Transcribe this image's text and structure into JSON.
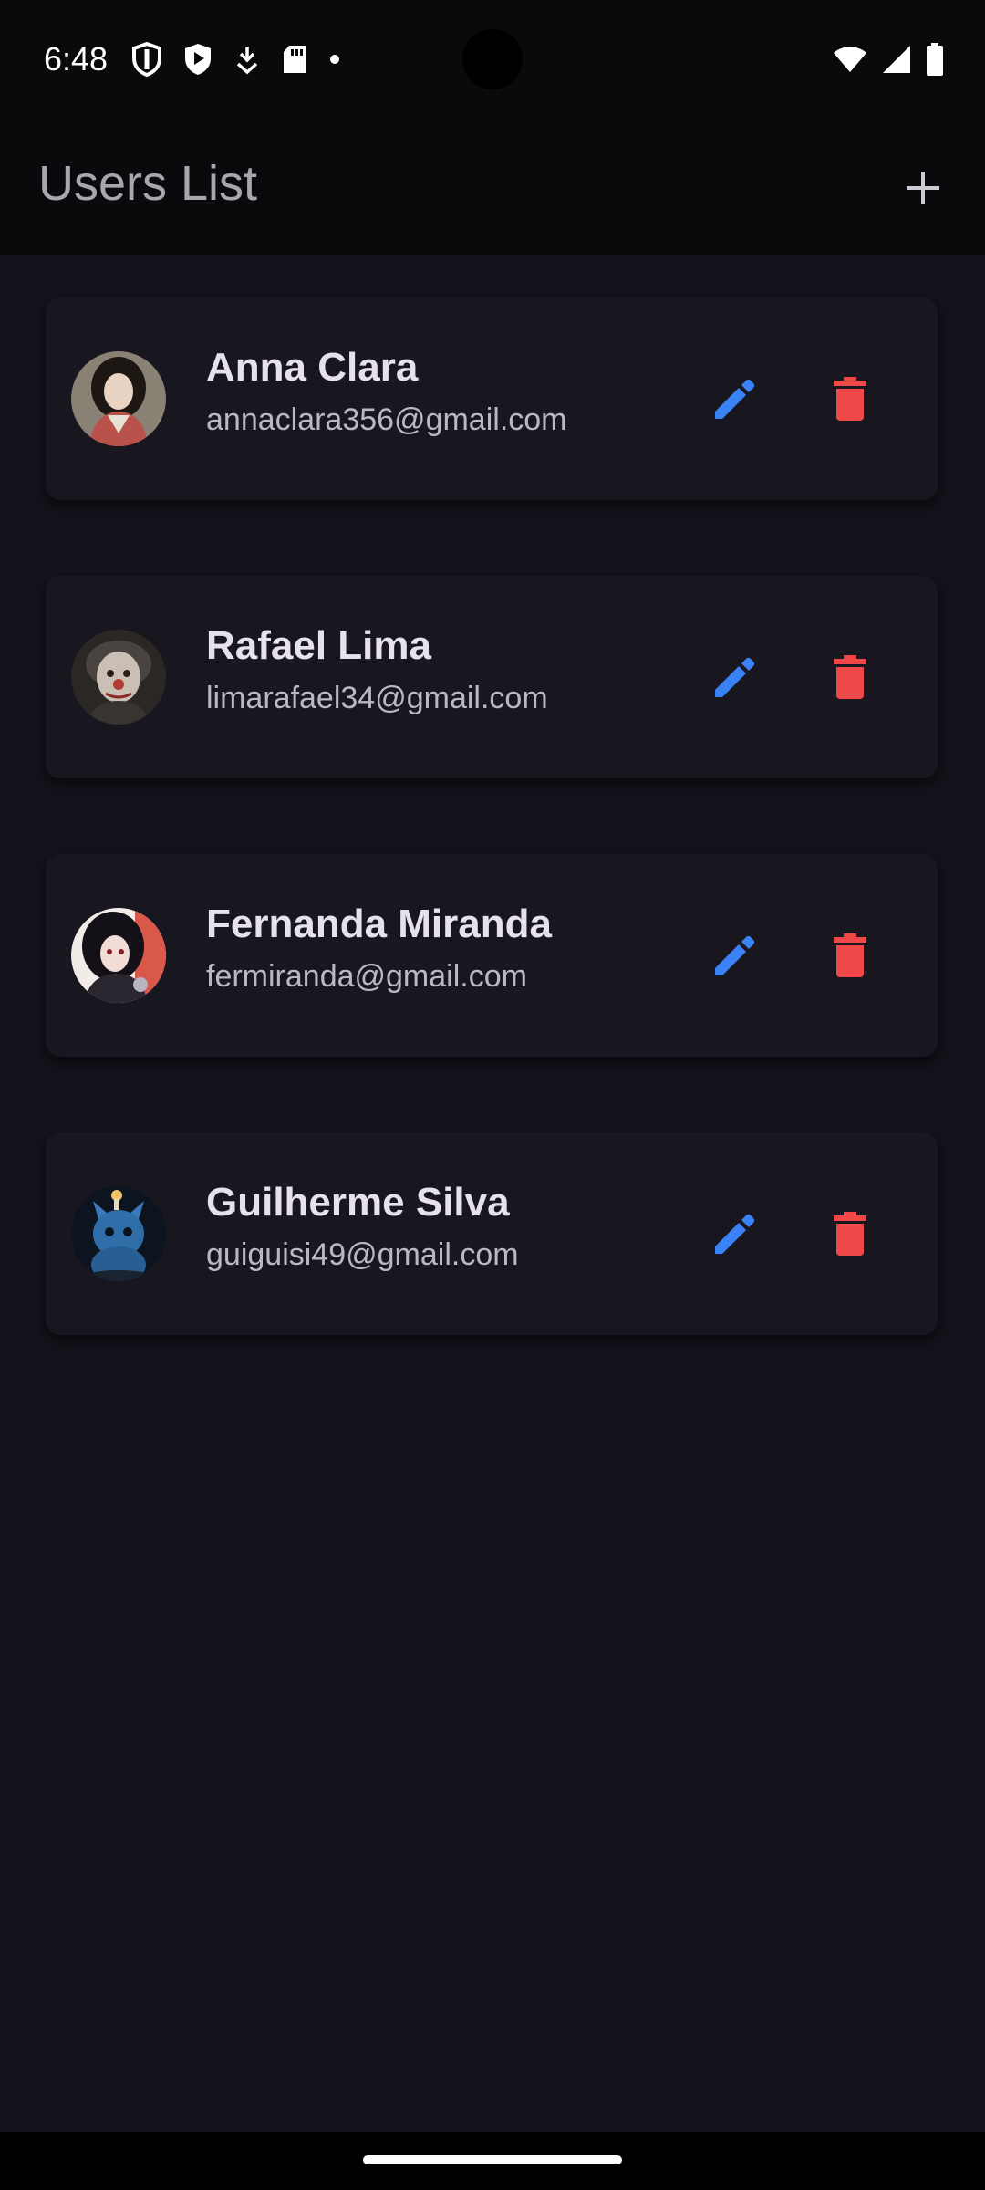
{
  "status_bar": {
    "time": "6:48"
  },
  "app_bar": {
    "title": "Users List",
    "add_icon": "plus-icon"
  },
  "colors": {
    "edit": "#3b82f6",
    "delete": "#f04848",
    "background": "#14121a",
    "card": "#18161e",
    "app_bar": "#0a090c"
  },
  "users": [
    {
      "name": "Anna Clara",
      "email": "annaclara356@gmail.com",
      "avatar_icon": "avatar-photo"
    },
    {
      "name": "Rafael Lima",
      "email": "limarafael34@gmail.com",
      "avatar_icon": "avatar-photo"
    },
    {
      "name": "Fernanda Miranda",
      "email": "fermiranda@gmail.com",
      "avatar_icon": "avatar-photo"
    },
    {
      "name": "Guilherme Silva",
      "email": "guiguisi49@gmail.com",
      "avatar_icon": "avatar-photo"
    }
  ]
}
